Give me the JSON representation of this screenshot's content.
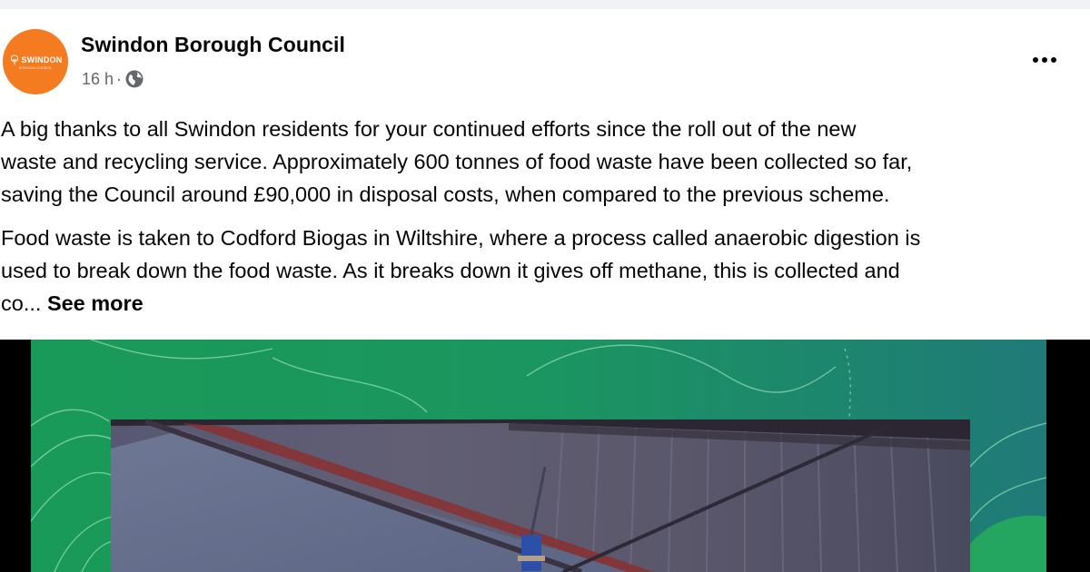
{
  "post": {
    "author": "Swindon Borough Council",
    "avatar_word": "SWINDON",
    "avatar_sub": "BOROUGH COUNCIL",
    "timestamp": "16 h",
    "separator": "·",
    "privacy_icon": "globe-icon",
    "more_icon": "more-options-icon",
    "paragraph_1_lines": [
      "A big thanks to all Swindon residents for your continued efforts since the roll out of the new",
      "waste and recycling service. Approximately 600 tonnes of food waste have been collected so far,",
      "saving the Council around £90,000 in disposal costs, when compared to the previous scheme."
    ],
    "paragraph_2_lines": [
      "Food waste is taken to Codford Biogas in Wiltshire, where a process called anaerobic digestion is",
      "used to break down the food waste. As it breaks down it gives off methane, this is collected and",
      "co... "
    ],
    "see_more": "See more"
  },
  "colors": {
    "page_bg": "#f0f2f5",
    "card_bg": "#ffffff",
    "text_primary": "#050505",
    "text_secondary": "#65676b",
    "brand_orange": "#f47b20",
    "video_green": "#1e9b5c"
  }
}
